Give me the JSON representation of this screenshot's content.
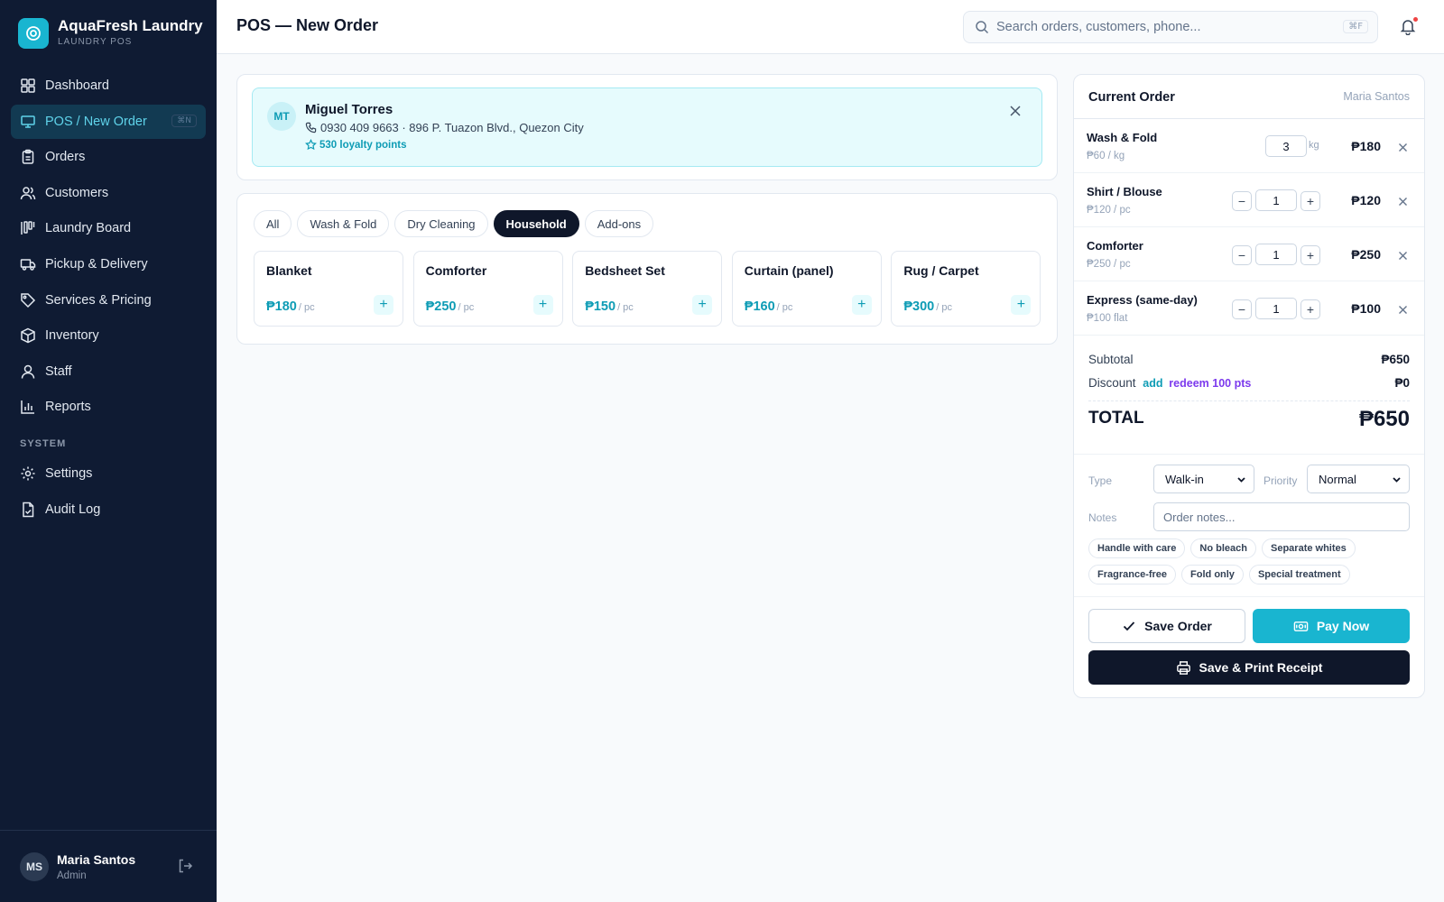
{
  "brand": {
    "name": "AquaFresh Laundry",
    "subtitle": "LAUNDRY POS"
  },
  "nav": [
    {
      "label": "Dashboard",
      "icon": "dashboard-icon"
    },
    {
      "label": "POS / New Order",
      "icon": "monitor-icon",
      "active": true,
      "shortcut": "⌘N"
    },
    {
      "label": "Orders",
      "icon": "clipboard-icon"
    },
    {
      "label": "Customers",
      "icon": "users-icon"
    },
    {
      "label": "Laundry Board",
      "icon": "kanban-icon"
    },
    {
      "label": "Pickup & Delivery",
      "icon": "truck-icon"
    },
    {
      "label": "Services & Pricing",
      "icon": "tag-icon"
    },
    {
      "label": "Inventory",
      "icon": "box-icon"
    },
    {
      "label": "Staff",
      "icon": "user-icon"
    },
    {
      "label": "Reports",
      "icon": "bar-chart-icon"
    }
  ],
  "system_section": "SYSTEM",
  "system_nav": [
    {
      "label": "Settings",
      "icon": "gear-icon"
    },
    {
      "label": "Audit Log",
      "icon": "file-check-icon"
    }
  ],
  "user": {
    "initials": "MS",
    "name": "Maria Santos",
    "role": "Admin"
  },
  "header": {
    "title": "POS — New Order",
    "search_placeholder": "Search orders, customers, phone...",
    "search_shortcut": "⌘F"
  },
  "customer": {
    "initials": "MT",
    "name": "Miguel Torres",
    "contact": "0930 409 9663 · 896 P. Tuazon Blvd., Quezon City",
    "points": "530 loyalty points"
  },
  "tabs": [
    {
      "label": "All"
    },
    {
      "label": "Wash & Fold"
    },
    {
      "label": "Dry Cleaning"
    },
    {
      "label": "Household",
      "active": true
    },
    {
      "label": "Add-ons"
    }
  ],
  "services": [
    {
      "name": "Blanket",
      "price": "₱180",
      "unit": "/ pc"
    },
    {
      "name": "Comforter",
      "price": "₱250",
      "unit": "/ pc"
    },
    {
      "name": "Bedsheet Set",
      "price": "₱150",
      "unit": "/ pc"
    },
    {
      "name": "Curtain (panel)",
      "price": "₱160",
      "unit": "/ pc"
    },
    {
      "name": "Rug / Carpet",
      "price": "₱300",
      "unit": "/ pc"
    }
  ],
  "order": {
    "title": "Current Order",
    "staff": "Maria Santos",
    "lines": [
      {
        "name": "Wash & Fold",
        "rate": "₱60 / kg",
        "qty": "3",
        "unit": "kg",
        "amount": "₱180"
      },
      {
        "name": "Shirt / Blouse",
        "rate": "₱120 / pc",
        "qty": "1",
        "amount": "₱120"
      },
      {
        "name": "Comforter",
        "rate": "₱250 / pc",
        "qty": "1",
        "amount": "₱250"
      },
      {
        "name": "Express (same-day)",
        "rate": "₱100 flat",
        "qty": "1",
        "amount": "₱100"
      }
    ],
    "subtotal_label": "Subtotal",
    "subtotal": "₱650",
    "discount_label": "Discount",
    "discount_add": "add",
    "discount_redeem": "redeem 100 pts",
    "discount": "₱0",
    "total_label": "TOTAL",
    "total": "₱650",
    "type_label": "Type",
    "type_value": "Walk-in",
    "priority_label": "Priority",
    "priority_value": "Normal",
    "notes_label": "Notes",
    "notes_placeholder": "Order notes...",
    "chips": [
      "Handle with care",
      "No bleach",
      "Separate whites",
      "Fragrance-free",
      "Fold only",
      "Special treatment"
    ],
    "save_label": "Save Order",
    "pay_label": "Pay Now",
    "print_label": "Save & Print Receipt"
  },
  "colors": {
    "accent": "#19b5d0",
    "sidebar": "#0f1b33",
    "dark": "#0f172a",
    "purple": "#7c3aed"
  }
}
